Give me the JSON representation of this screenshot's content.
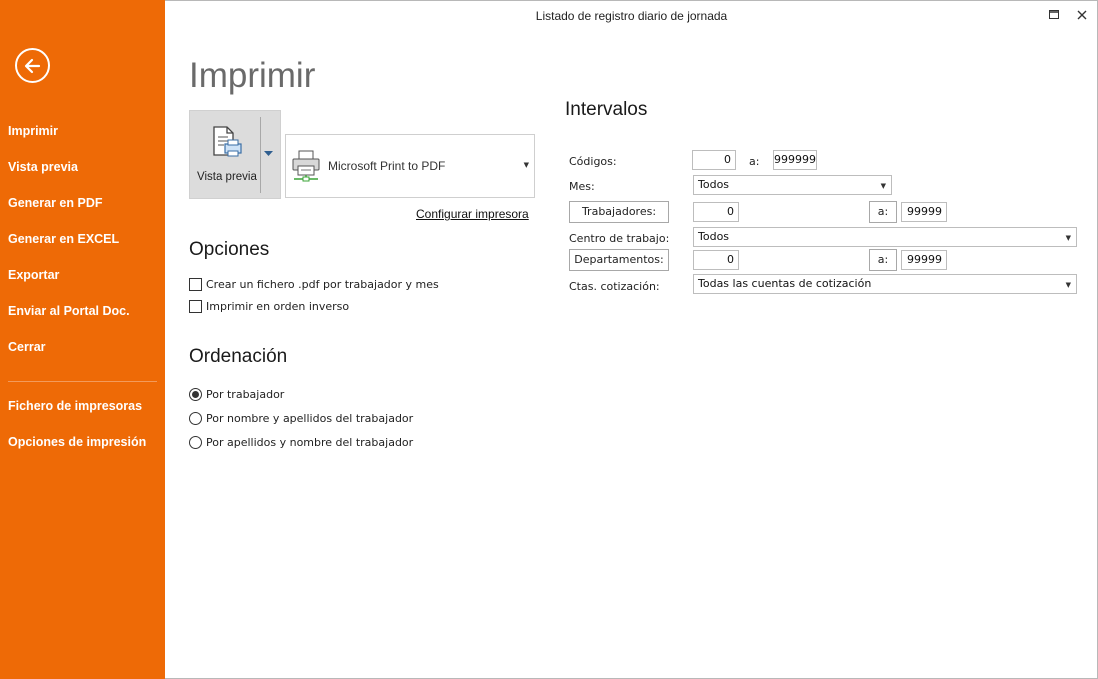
{
  "window": {
    "title": "Listado de registro diario de jornada"
  },
  "sidebar": {
    "items": [
      {
        "label": "Imprimir"
      },
      {
        "label": "Vista previa"
      },
      {
        "label": "Generar en PDF"
      },
      {
        "label": "Generar en EXCEL"
      },
      {
        "label": "Exportar"
      },
      {
        "label": "Enviar al Portal Doc."
      },
      {
        "label": "Cerrar"
      }
    ],
    "items2": [
      {
        "label": "Fichero de impresoras"
      },
      {
        "label": "Opciones de impresión"
      }
    ],
    "bg_color": "#ee6a06"
  },
  "main": {
    "title": "Imprimir",
    "preview_label": "Vista previa",
    "printer_name": "Microsoft Print to PDF",
    "configure_link": "Configurar impresora"
  },
  "options": {
    "heading": "Opciones",
    "checks": [
      {
        "label": "Crear un fichero .pdf por trabajador y mes",
        "checked": false
      },
      {
        "label": "Imprimir en orden inverso",
        "checked": false
      }
    ]
  },
  "ordering": {
    "heading": "Ordenación",
    "radios": [
      {
        "label": "Por trabajador",
        "selected": true
      },
      {
        "label": "Por nombre y apellidos del trabajador",
        "selected": false
      },
      {
        "label": "Por apellidos y nombre del trabajador",
        "selected": false
      }
    ]
  },
  "intervals": {
    "heading": "Intervalos",
    "codigos_label": "Códigos:",
    "codigos_from": "0",
    "codigos_to_label": "a:",
    "codigos_to": "999999",
    "mes_label": "Mes:",
    "mes_value": "Todos",
    "trabajadores_label": "Trabajadores:",
    "trabajadores_from": "0",
    "trabajadores_to_label": "a:",
    "trabajadores_to": "99999",
    "centro_label": "Centro de trabajo:",
    "centro_value": "Todos",
    "departamentos_label": "Departamentos:",
    "departamentos_from": "0",
    "departamentos_to_label": "a:",
    "departamentos_to": "99999",
    "ctas_label": "Ctas. cotización:",
    "ctas_value": "Todas las cuentas de cotización"
  }
}
